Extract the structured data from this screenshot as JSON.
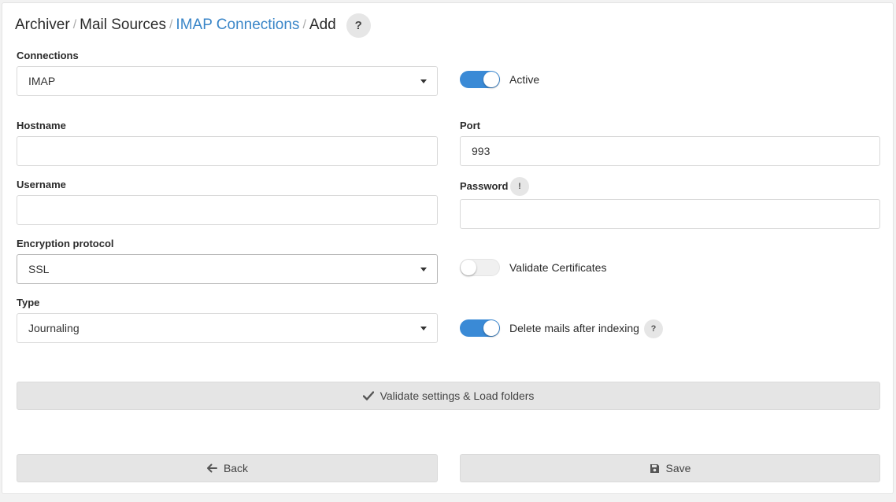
{
  "breadcrumb": {
    "items": [
      "Archiver",
      "Mail Sources",
      "IMAP Connections",
      "Add"
    ],
    "separator": "/",
    "help_glyph": "?"
  },
  "form": {
    "connections": {
      "label": "Connections",
      "value": "IMAP"
    },
    "active": {
      "label": "Active",
      "on": true
    },
    "hostname": {
      "label": "Hostname",
      "value": ""
    },
    "port": {
      "label": "Port",
      "value": "993"
    },
    "username": {
      "label": "Username",
      "value": ""
    },
    "password": {
      "label": "Password",
      "value": "",
      "info_glyph": "!"
    },
    "encryption": {
      "label": "Encryption protocol",
      "value": "SSL"
    },
    "validate_certificates": {
      "label": "Validate Certificates",
      "on": false
    },
    "type": {
      "label": "Type",
      "value": "Journaling"
    },
    "delete_mails": {
      "label": "Delete mails after indexing",
      "on": true,
      "help_glyph": "?"
    }
  },
  "actions": {
    "validate_label": "Validate settings & Load folders",
    "back_label": "Back",
    "save_label": "Save"
  },
  "colors": {
    "accent": "#3a8ad6",
    "link": "#3a86c8",
    "button_bg": "#e5e5e5"
  },
  "icons": {
    "validate": "check-icon",
    "back": "arrow-left-icon",
    "save": "floppy-disk-icon",
    "select": "chevron-down-icon"
  }
}
